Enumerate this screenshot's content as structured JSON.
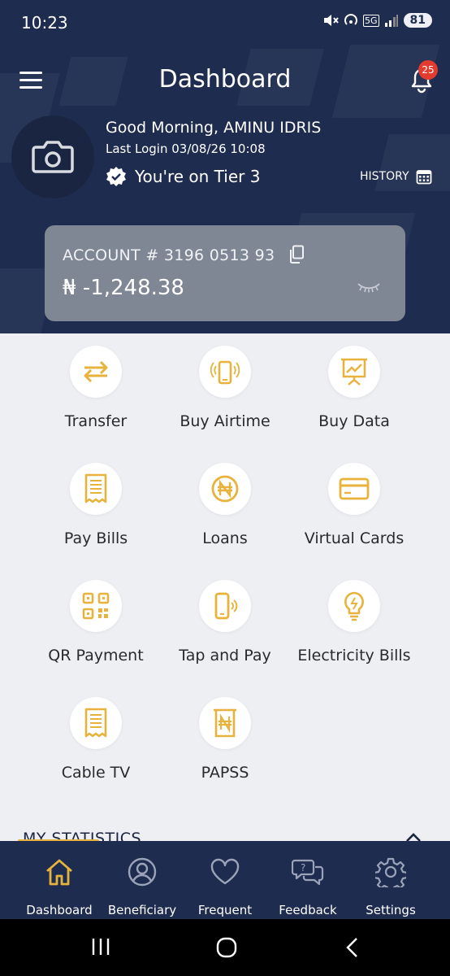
{
  "status_bar": {
    "time": "10:23",
    "network": "5G",
    "battery": "81"
  },
  "header": {
    "title": "Dashboard",
    "notification_count": "25",
    "greeting": "Good Morning, AMINU IDRIS",
    "last_login": "Last Login 03/08/26 10:08",
    "tier": "You're on Tier 3",
    "history_label": "HISTORY"
  },
  "account": {
    "label": "ACCOUNT # 3196 0513 93",
    "balance": "₦ -1,248.38"
  },
  "services": [
    {
      "label": "Transfer",
      "icon": "transfer-arrows-icon"
    },
    {
      "label": "Buy Airtime",
      "icon": "phone-ringing-icon"
    },
    {
      "label": "Buy Data",
      "icon": "presentation-chart-icon"
    },
    {
      "label": "Pay Bills",
      "icon": "receipt-icon"
    },
    {
      "label": "Loans",
      "icon": "naira-coin-icon"
    },
    {
      "label": "Virtual Cards",
      "icon": "credit-card-icon"
    },
    {
      "label": "QR Payment",
      "icon": "qr-code-icon"
    },
    {
      "label": "Tap and Pay",
      "icon": "contactless-phone-icon"
    },
    {
      "label": "Electricity Bills",
      "icon": "lightbulb-icon"
    },
    {
      "label": "Cable TV",
      "icon": "receipt-icon"
    },
    {
      "label": "PAPSS",
      "icon": "naira-receipt-icon"
    }
  ],
  "statistics": {
    "title": "MY STATISTICS"
  },
  "bottom_nav": [
    {
      "label": "Dashboard",
      "icon": "home-icon",
      "active": true
    },
    {
      "label": "Beneficiary",
      "icon": "user-circle-icon",
      "active": false
    },
    {
      "label": "Frequent",
      "icon": "heart-icon",
      "active": false
    },
    {
      "label": "Feedback",
      "icon": "chat-question-icon",
      "active": false
    },
    {
      "label": "Settings",
      "icon": "gear-icon",
      "active": false
    }
  ],
  "colors": {
    "navy": "#1e2c4f",
    "accent": "#e8b33c",
    "badge": "#e33b2d",
    "content_bg": "#eeeff3"
  }
}
